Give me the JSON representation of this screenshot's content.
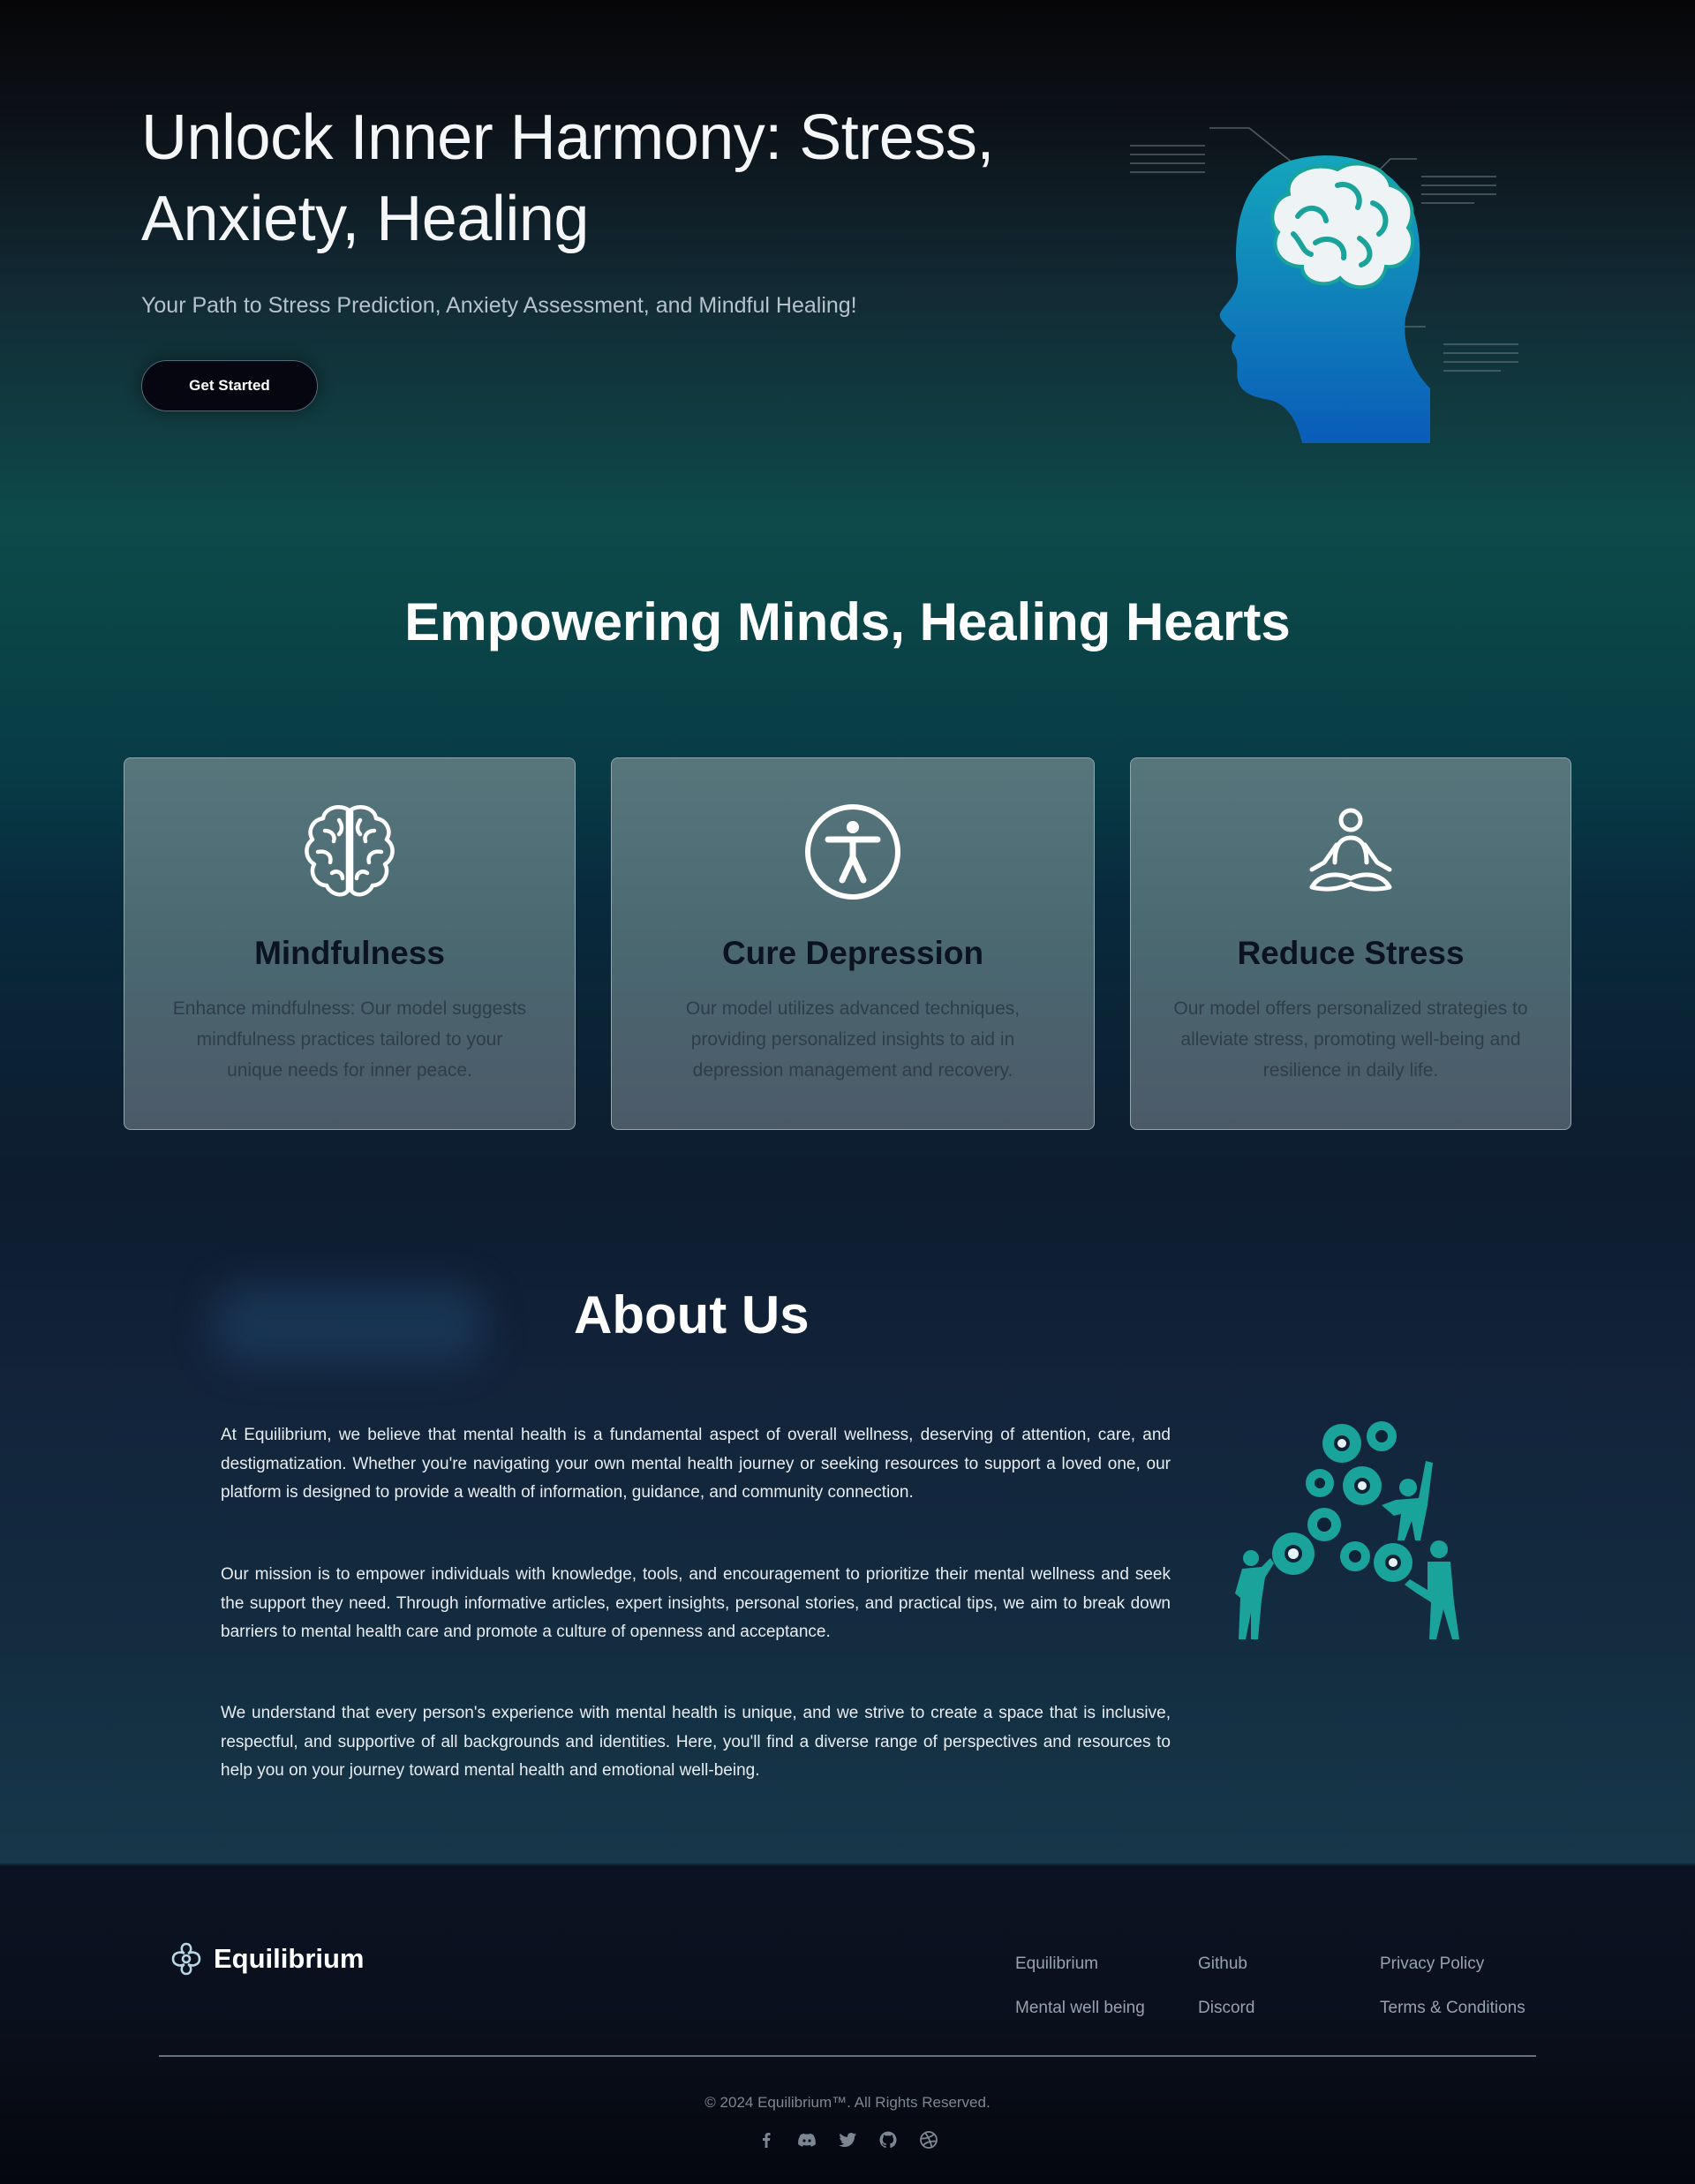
{
  "hero": {
    "title_line1": "Unlock Inner Harmony: Stress,",
    "title_line2": "Anxiety, Healing",
    "subtitle": "Your Path to Stress Prediction, Anxiety Assessment, and Mindful Healing!",
    "cta_label": "Get Started",
    "illustration_icon": "head-brain-illustration"
  },
  "features": {
    "title": "Empowering Minds, Healing Hearts",
    "cards": [
      {
        "icon": "brain-icon",
        "title": "Mindfulness",
        "text": "Enhance mindfulness: Our model suggests mindfulness practices tailored to your unique needs for inner peace."
      },
      {
        "icon": "accessibility-icon",
        "title": "Cure Depression",
        "text": "Our model utilizes advanced techniques, providing personalized insights to aid in depression management and recovery."
      },
      {
        "icon": "meditation-icon",
        "title": "Reduce Stress",
        "text": "Our model offers personalized strategies to alleviate stress, promoting well-being and resilience in daily life."
      }
    ]
  },
  "about": {
    "title": "About Us",
    "paragraphs": [
      "At Equilibrium, we believe that mental health is a fundamental aspect of overall wellness, deserving of attention, care, and destigmatization. Whether you're navigating your own mental health journey or seeking resources to support a loved one, our platform is designed to provide a wealth of information, guidance, and community connection.",
      "Our mission is to empower individuals with knowledge, tools, and encouragement to prioritize their mental wellness and seek the support they need. Through informative articles, expert insights, personal stories, and practical tips, we aim to break down barriers to mental health care and promote a culture of openness and acceptance.",
      "We understand that every person's experience with mental health is unique, and we strive to create a space that is inclusive, respectful, and supportive of all backgrounds and identities. Here, you'll find a diverse range of perspectives and resources to help you on your journey toward mental health and emotional well-being."
    ],
    "illustration_icon": "teamwork-gears-illustration"
  },
  "footer": {
    "brand": "Equilibrium",
    "brand_icon": "equilibrium-logo-icon",
    "links": [
      [
        "Equilibrium",
        "Mental well being"
      ],
      [
        "Github",
        "Discord"
      ],
      [
        "Privacy Policy",
        "Terms & Conditions"
      ]
    ],
    "copyright": "© 2024 Equilibrium™. All Rights Reserved.",
    "socials": [
      "facebook-icon",
      "discord-icon",
      "twitter-icon",
      "github-icon",
      "dribbble-icon"
    ]
  },
  "colors": {
    "accent_teal": "#1aa39a",
    "brain_blue": "#0a7fb8",
    "card_bg": "#56767c",
    "button_bg": "#05060f"
  }
}
